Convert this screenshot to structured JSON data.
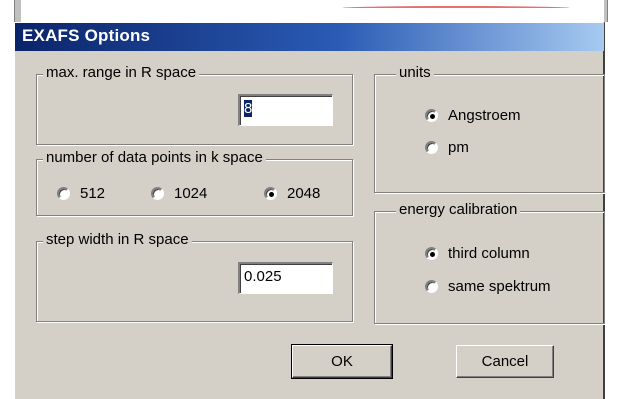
{
  "window": {
    "title": "EXAFS Options"
  },
  "range_group": {
    "label": "max. range in R space",
    "value": "8"
  },
  "points_group": {
    "label": "number of data points in k space",
    "options": [
      {
        "label": "512",
        "checked": false
      },
      {
        "label": "1024",
        "checked": false
      },
      {
        "label": "2048",
        "checked": true
      }
    ]
  },
  "step_group": {
    "label": "step width in R space",
    "value": "0.025"
  },
  "units_group": {
    "label": "units",
    "options": [
      {
        "label": "Angstroem",
        "checked": true
      },
      {
        "label": "pm",
        "checked": false
      }
    ]
  },
  "energy_group": {
    "label": "energy calibration",
    "options": [
      {
        "label": "third column",
        "checked": true
      },
      {
        "label": "same spektrum",
        "checked": false
      }
    ]
  },
  "buttons": {
    "ok": "OK",
    "cancel": "Cancel"
  },
  "colors": {
    "title_start": "#0a246a",
    "title_end": "#a6caf0",
    "face": "#d4d0c8",
    "selection": "#0a246a"
  }
}
